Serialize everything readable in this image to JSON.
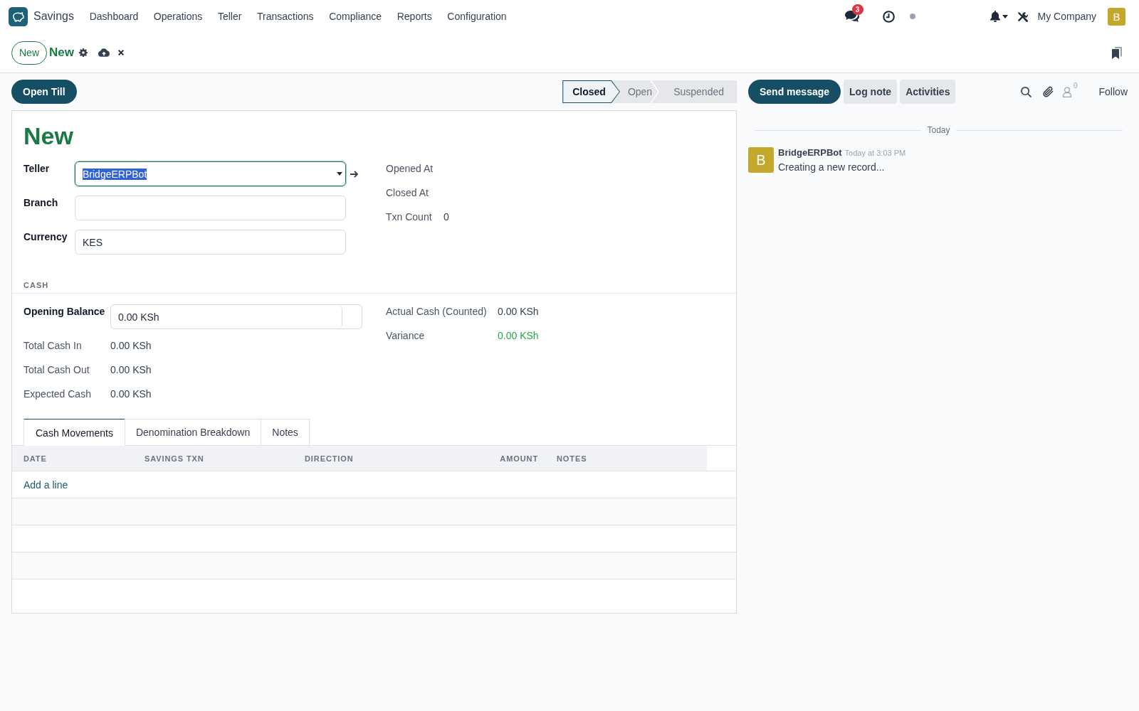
{
  "navbar": {
    "app_name": "Savings",
    "menu": [
      "Dashboard",
      "Operations",
      "Teller",
      "Transactions",
      "Compliance",
      "Reports",
      "Configuration"
    ],
    "messages_count": "3",
    "company": "My Company",
    "avatar_initial": "B"
  },
  "control_panel": {
    "new_button": "New",
    "breadcrumb": "New"
  },
  "header": {
    "buttons": [
      "Open Till"
    ],
    "statusbar": [
      {
        "label": "Closed",
        "selected": true
      },
      {
        "label": "Open",
        "selected": false
      },
      {
        "label": "Suspended",
        "selected": false
      }
    ]
  },
  "sheet": {
    "title": "New",
    "main_left": [
      {
        "label": "Teller",
        "value": "BridgeERPBot",
        "focused": true
      },
      {
        "label": "Branch",
        "focused": false
      },
      {
        "label": "Currency",
        "value": "KES",
        "focused": false
      }
    ],
    "main_right": [
      {
        "label": "Opened At"
      },
      {
        "label": "Closed At"
      },
      {
        "label": "Txn Count",
        "value": "0"
      }
    ],
    "section": "CASH",
    "cash_left": [
      {
        "label": "Opening Balance",
        "value": "0.00 KSh",
        "kind": "input"
      },
      {
        "label": "Total Cash In",
        "value": "0.00 KSh",
        "kind": "readonly"
      },
      {
        "label": "Total Cash Out",
        "value": "0.00 KSh",
        "kind": "readonly"
      },
      {
        "label": "Expected Cash",
        "value": "0.00 KSh",
        "kind": "readonly"
      }
    ],
    "cash_right": [
      {
        "label": "Actual Cash (Counted)",
        "value": "0.00 KSh"
      },
      {
        "label": "Variance",
        "value": "0.00 KSh",
        "color": "#28a745"
      }
    ],
    "notebook": {
      "tabs": [
        {
          "label": "Cash Movements",
          "selected": true
        },
        {
          "label": "Denomination Breakdown",
          "selected": false
        },
        {
          "label": "Notes",
          "selected": false
        }
      ],
      "columns": [
        "DATE",
        "SAVINGS TXN",
        "DIRECTION",
        "AMOUNT",
        "NOTES"
      ],
      "add_line": "Add a line"
    }
  },
  "chatter": {
    "buttons": [
      {
        "label": "Send message",
        "kind": "primary"
      },
      {
        "label": "Log note",
        "kind": "secondary"
      },
      {
        "label": "Activities",
        "kind": "secondary"
      }
    ],
    "followers_count": "0",
    "follow": "Follow",
    "date_divider": "Today",
    "messages": [
      {
        "author": "BridgeERPBot",
        "avatar_initial": "B",
        "time": "Today at 3:03 PM",
        "body": "Creating a new record..."
      }
    ]
  }
}
